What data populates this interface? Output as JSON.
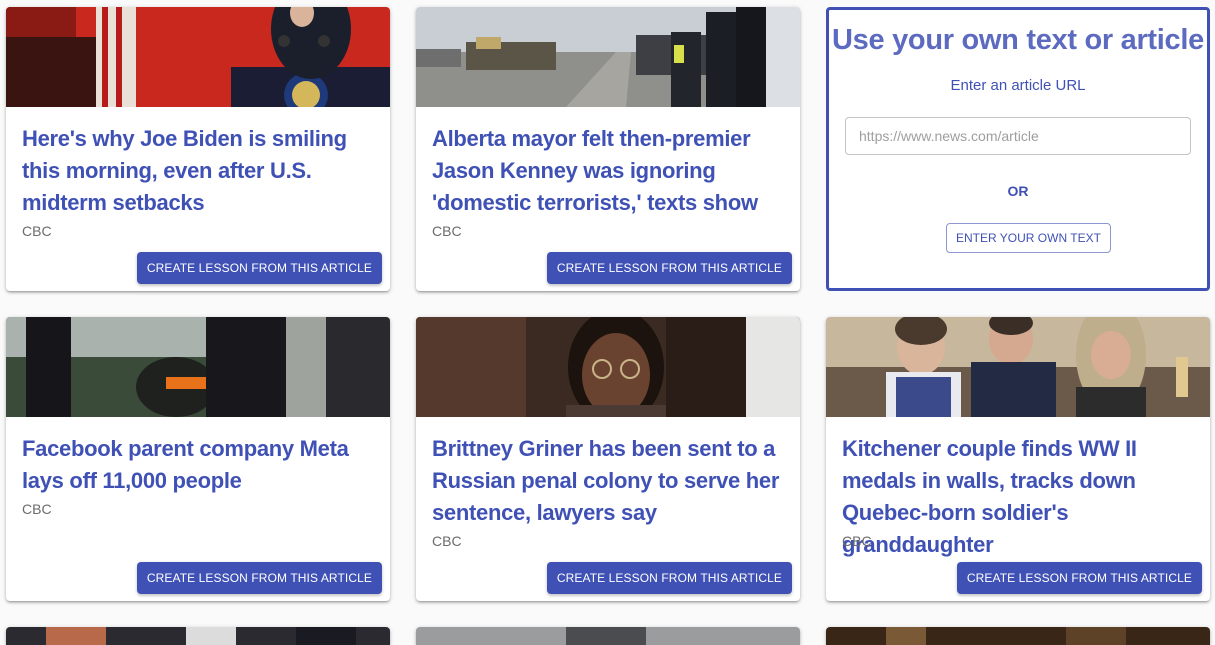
{
  "articles": [
    {
      "headline": "Here's why Joe Biden is smiling this morning, even after U.S. midterm setbacks",
      "source": "CBC",
      "button": "CREATE LESSON FROM THIS ARTICLE"
    },
    {
      "headline": "Alberta mayor felt then-premier Jason Kenney was ignoring 'domestic terrorists,' texts show",
      "source": "CBC",
      "button": "CREATE LESSON FROM THIS ARTICLE"
    },
    {
      "headline": "Facebook parent company Meta lays off 11,000 people",
      "source": "CBC",
      "button": "CREATE LESSON FROM THIS ARTICLE"
    },
    {
      "headline": "Brittney Griner has been sent to a Russian penal colony to serve her sentence, lawyers say",
      "source": "CBC",
      "button": "CREATE LESSON FROM THIS ARTICLE"
    },
    {
      "headline": "Kitchener couple finds WW II medals in walls, tracks down Quebec-born soldier's granddaughter",
      "source": "CBC",
      "button": "CREATE LESSON FROM THIS ARTICLE"
    }
  ],
  "own_text": {
    "title": "Use your own text or article",
    "url_label": "Enter an article URL",
    "url_placeholder": "https://www.news.com/article",
    "or": "OR",
    "button": "ENTER YOUR OWN TEXT"
  }
}
